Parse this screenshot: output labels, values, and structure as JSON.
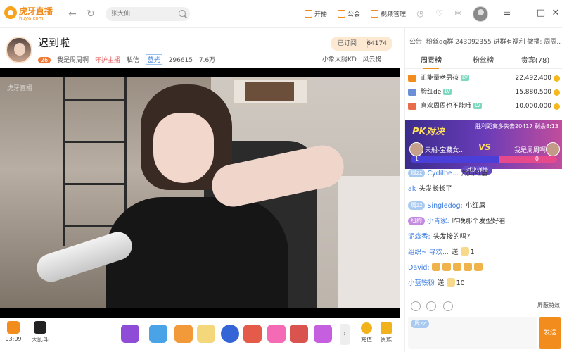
{
  "app": {
    "logo_main": "虎牙直播",
    "logo_sub": "huya.com"
  },
  "topbar": {
    "search_placeholder": "张大仙",
    "items": [
      {
        "label": "开播"
      },
      {
        "label": "公会"
      },
      {
        "label": "视频管理"
      }
    ]
  },
  "room": {
    "title": "迟到啦",
    "level": "26",
    "streamer": "我是周周啊",
    "guard": "守护主播",
    "private_msg": "私信",
    "quality": "蓝光",
    "viewers": "296615",
    "likes": "7.6万",
    "subscribe_label": "已订阅",
    "subscribers": "64174",
    "right_meta_1": "小象大腿KD",
    "right_meta_2": "风云榜",
    "watermark": "虎牙直播"
  },
  "bottom": {
    "left": [
      {
        "label": "03:09"
      },
      {
        "label": "大乱斗"
      }
    ],
    "right": [
      {
        "label": "充值"
      },
      {
        "label": "贵族"
      }
    ]
  },
  "panel": {
    "notice": "公告: 粉丝qq群 243092355 进群有福利 微播: 周周...",
    "tabs": [
      {
        "label": "周贡榜"
      },
      {
        "label": "粉丝榜"
      },
      {
        "label": "贵宾(78)"
      }
    ],
    "ranks": [
      {
        "name": "正能量老男孩",
        "tag": "LV",
        "value": "22,492,400"
      },
      {
        "name": "脸红de",
        "tag": "LV",
        "value": "15,880,500"
      },
      {
        "name": "喜欢周周也不能哦",
        "tag": "LV",
        "value": "10,000,000"
      }
    ],
    "pk": {
      "title": "PK对决",
      "info": "胜利距离多失去20417 剩余8:13",
      "left_name": "天船-宝藏女...",
      "right_name": "我是周周啊",
      "vs": "VS",
      "left_score": "1",
      "right_score": "0",
      "detail": "对决详情",
      "left_score_share": 0.6
    },
    "chat": [
      {
        "fan": "周zz",
        "user": "Cydilbe...",
        "msg": "烈焰红唇"
      },
      {
        "fan": "",
        "user": "ak",
        "msg": "头发长长了"
      },
      {
        "fan": "周zz",
        "user": "Singledog:",
        "msg": "小红唇"
      },
      {
        "fan": "纽约",
        "user": "小青家:",
        "msg": "昨晚那个发型好看"
      },
      {
        "fan": "",
        "user": "泥森香:",
        "msg": "头发接的吗?"
      },
      {
        "fan": "",
        "user": "组织~ 寻欢...",
        "msg": "送",
        "count": "1"
      },
      {
        "fan": "",
        "user": "David:",
        "msg": ""
      },
      {
        "fan": "",
        "user": "小蓝铁粉",
        "msg": "送",
        "count": "10"
      }
    ],
    "effects_label": "屏蔽特效",
    "input_fan": "周zz",
    "send_label": "发送"
  },
  "colors": {
    "brand": "#f28d1d",
    "link": "#3c7be0"
  }
}
